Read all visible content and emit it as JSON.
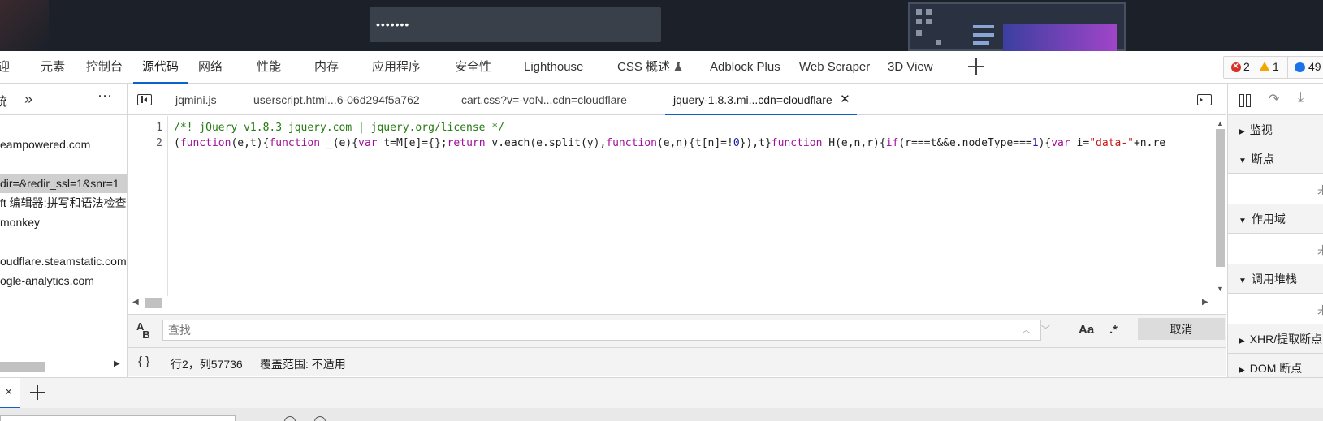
{
  "page": {
    "password_mask": "•••••••"
  },
  "main_tabs": [
    {
      "label": "迎"
    },
    {
      "label": "元素"
    },
    {
      "label": "控制台"
    },
    {
      "label": "源代码"
    },
    {
      "label": "网络"
    },
    {
      "label": "性能"
    },
    {
      "label": "内存"
    },
    {
      "label": "应用程序"
    },
    {
      "label": "安全性"
    },
    {
      "label": "Lighthouse"
    },
    {
      "label": "CSS 概述"
    },
    {
      "label": "Adblock Plus"
    },
    {
      "label": "Web Scraper"
    },
    {
      "label": "3D View"
    }
  ],
  "active_main_tab": "源代码",
  "issues": {
    "errors": "2",
    "warnings": "1",
    "messages": "49"
  },
  "navigator": {
    "header_label": "统",
    "items": [
      {
        "label": "eampowered.com"
      },
      {
        "label": "dir=&redir_ssl=1&snr=1"
      },
      {
        "label": "ft 编辑器:拼写和语法检查"
      },
      {
        "label": "monkey"
      },
      {
        "label": "oudflare.steamstatic.com"
      },
      {
        "label": "ogle-analytics.com"
      }
    ]
  },
  "editor_tabs": [
    {
      "label": "jqmini.js"
    },
    {
      "label": "userscript.html...6-06d294f5a762"
    },
    {
      "label": "cart.css?v=-voN...cdn=cloudflare"
    },
    {
      "label": "jquery-1.8.3.mi...cdn=cloudflare"
    }
  ],
  "code": {
    "line_numbers": [
      "1",
      "2"
    ],
    "line1": "/*! jQuery v1.8.3 jquery.com | jquery.org/license */",
    "line2_tokens": {
      "t1": "(",
      "t2": "function",
      "t3": "(e,t){",
      "t4": "function",
      "t5": " _(e){",
      "t6": "var",
      "t7": " t=M[e]={};",
      "t8": "return",
      "t9": " v.each(e.split(y),",
      "t10": "function",
      "t11": "(e,n){t[n]=!",
      "t12": "0",
      "t13": "}),t}",
      "t14": "function",
      "t15": " H(e,n,r){",
      "t16": "if",
      "t17": "(r===t&&e.nodeType===",
      "t18": "1",
      "t19": "){",
      "t20": "var",
      "t21": " i=",
      "t22": "\"data-\"",
      "t23": "+n.re"
    }
  },
  "search": {
    "placeholder": "查找",
    "case_label": "Aa",
    "regex_label": ".*",
    "cancel_label": "取消"
  },
  "status": {
    "braces": "{ }",
    "position": "行2，列57736",
    "coverage": "覆盖范围: 不适用"
  },
  "debugger": {
    "sections": [
      {
        "label": "监视",
        "expanded": false
      },
      {
        "label": "断点",
        "expanded": true,
        "body": "未"
      },
      {
        "label": "作用域",
        "expanded": true,
        "body": "未"
      },
      {
        "label": "调用堆栈",
        "expanded": true,
        "body": "未"
      },
      {
        "label": "XHR/提取断点",
        "expanded": false
      },
      {
        "label": "DOM 断点",
        "expanded": false
      }
    ]
  },
  "drawer": {
    "close_symbol": "×"
  },
  "colors": {
    "accent": "#0a64c8",
    "comment": "#237a10",
    "keyword": "#a0119b",
    "number": "#1a1aa6",
    "string": "#c41a16"
  }
}
